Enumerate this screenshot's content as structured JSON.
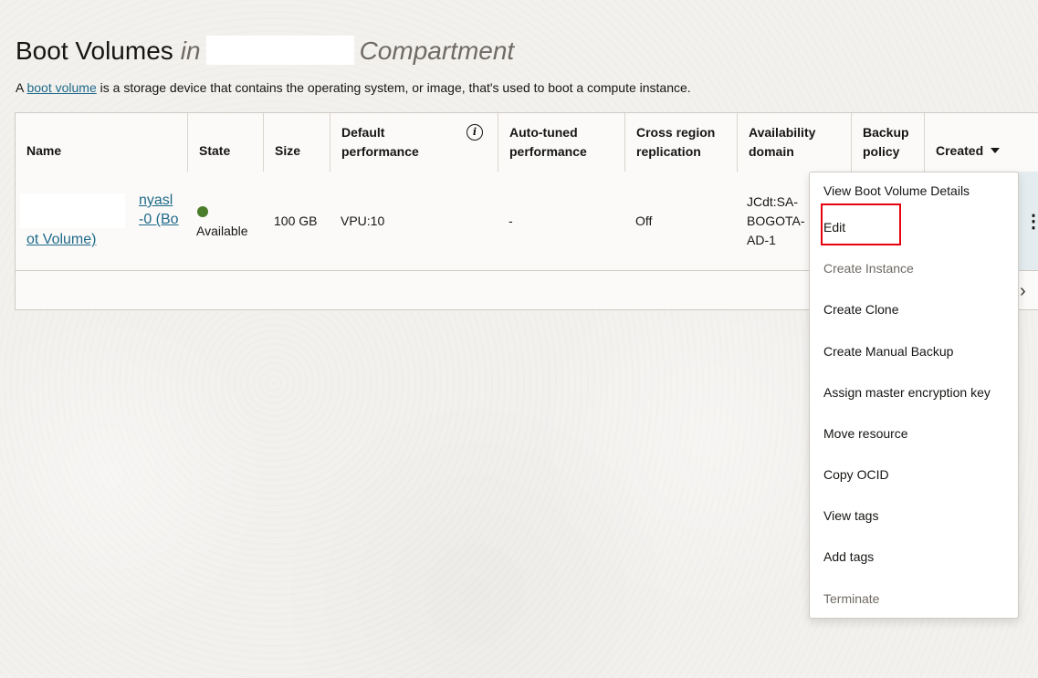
{
  "header": {
    "title_prefix": "Boot Volumes",
    "title_in": "in",
    "title_suffix": "Compartment",
    "description_before": "A ",
    "description_link": "boot volume",
    "description_after": " is a storage device that contains the operating system, or image, that's used to boot a compute instance."
  },
  "table": {
    "columns": {
      "name": "Name",
      "state": "State",
      "size": "Size",
      "default_performance_l1": "Default",
      "default_performance_l2": "performance",
      "auto_tuned_l1": "Auto-tuned",
      "auto_tuned_l2": "performance",
      "cross_region_l1": "Cross region",
      "cross_region_l2": "replication",
      "availability_l1": "Availability",
      "availability_l2": "domain",
      "backup_l1": "Backup",
      "backup_l2": "policy",
      "created": "Created"
    },
    "rows": [
      {
        "name_line1": "nyasl",
        "name_line2": "-0 (Bo",
        "name_line3": "ot Volume)",
        "state": "Available",
        "size": "100 GB",
        "default_performance": "VPU:10",
        "auto_tuned": "-",
        "cross_region": "Off",
        "availability_l1": "JCdt:SA-",
        "availability_l2": "BOGOTA-",
        "availability_l3": "AD-1"
      }
    ],
    "state_color": "#4a7d2b"
  },
  "menu": {
    "items": [
      {
        "label": "View Boot Volume Details",
        "disabled": false
      },
      {
        "label": "Edit",
        "disabled": false
      },
      {
        "label": "Create Instance",
        "disabled": true
      },
      {
        "label": "Create Clone",
        "disabled": false
      },
      {
        "label": "Create Manual Backup",
        "disabled": false
      },
      {
        "label": "Assign master encryption key",
        "disabled": false
      },
      {
        "label": "Move resource",
        "disabled": false
      },
      {
        "label": "Copy OCID",
        "disabled": false
      },
      {
        "label": "View tags",
        "disabled": false
      },
      {
        "label": "Add tags",
        "disabled": false
      },
      {
        "label": "Terminate",
        "disabled": true
      }
    ],
    "highlight_color": "#e8000e"
  },
  "icons": {
    "info": "info-icon",
    "sort": "caret-down-icon",
    "actions": "kebab-icon",
    "next": "chevron-right-icon"
  },
  "colors": {
    "link": "#1f6a8a",
    "background": "#f3f1ee"
  }
}
